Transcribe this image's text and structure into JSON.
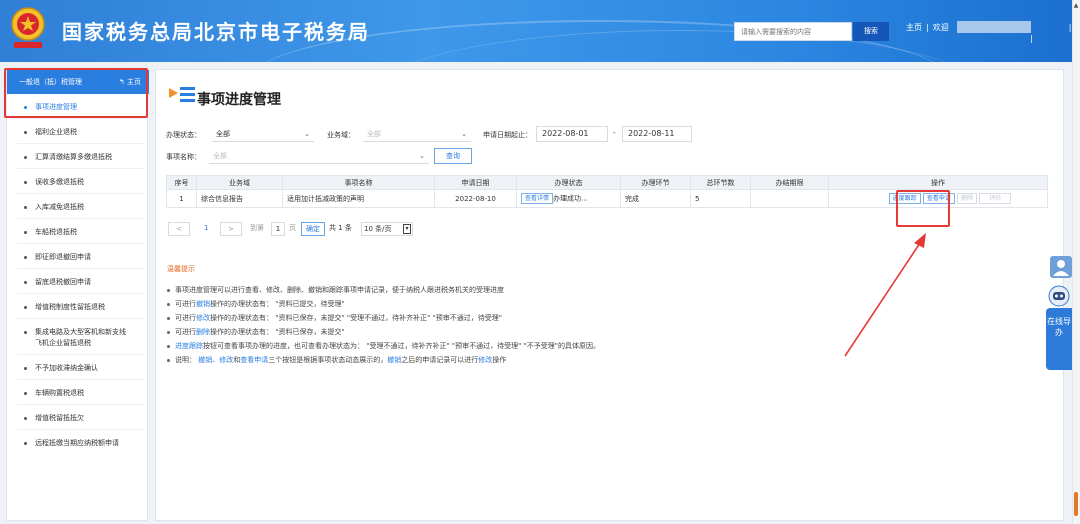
{
  "header": {
    "title": "国家税务总局北京市电子税务局",
    "search_placeholder": "请输入需要搜索的内容",
    "search_button": "搜索",
    "home": "主页",
    "welcome": "欢迎",
    "logout": "退出",
    "sep": "|"
  },
  "sidebar": {
    "head": "一般退（抵）税管理",
    "home": "主页",
    "items": [
      {
        "label": "事项进度管理"
      },
      {
        "label": "福利企业退税"
      },
      {
        "label": "汇算清缴结算多缴退抵税"
      },
      {
        "label": "误收多缴退抵税"
      },
      {
        "label": "入库减免退抵税"
      },
      {
        "label": "车船税退抵税"
      },
      {
        "label": "即征即退撤回申请"
      },
      {
        "label": "留底退税撤回申请"
      },
      {
        "label": "增值税制度性留抵退税"
      },
      {
        "label": "集成电路及大型客机和新支线飞机企业留抵退税"
      },
      {
        "label": "不予加收滞纳金确认"
      },
      {
        "label": "车辆购置税退税"
      },
      {
        "label": "增值税留抵抵欠"
      },
      {
        "label": "远程抵缴当期应纳税额申请"
      }
    ]
  },
  "page": {
    "title": "事项进度管理",
    "filters": {
      "status_label": "办理状态：",
      "status_value": "全部",
      "domain_label": "业务域：",
      "domain_value": "全部",
      "date_label": "申请日期起止：",
      "date_from": "2022-08-01",
      "date_dash": "-",
      "date_to": "2022-08-11",
      "name_label": "事项名称：",
      "name_value": "全部",
      "query_button": "查询"
    },
    "table": {
      "headers": [
        "序号",
        "业务域",
        "事项名称",
        "申请日期",
        "办理状态",
        "办理环节",
        "总环节数",
        "办结期限",
        "操作"
      ],
      "rows": [
        {
          "index": "1",
          "domain": "综合信息报告",
          "name": "适用加计抵减政策的声明",
          "date": "2022-08-10",
          "status_btn": "查看详情",
          "status": "办理成功...",
          "stage": "完成",
          "total": "5",
          "deadline": "",
          "ops": {
            "progress": "进度跟踪",
            "view": "查看申请",
            "delete": "删除",
            "rate": "评价"
          }
        }
      ]
    },
    "pager": {
      "prev": "<",
      "current": "1",
      "next": ">",
      "goto_label": "到第",
      "goto_value": "1",
      "page_unit": "页",
      "confirm": "确定",
      "total": "共 1 条",
      "per_page": "10 条/页"
    },
    "tips": {
      "title": "温馨提示",
      "lines": [
        {
          "parts": [
            {
              "t": "事项进度管理可以进行查看、修改、删除、撤销和跟踪事项申请记录，便于纳税人跟进税务机关的受理进度"
            }
          ]
        },
        {
          "parts": [
            {
              "t": "可进行"
            },
            {
              "t": "撤销",
              "link": true
            },
            {
              "t": "操作的办理状态有：  \"资料已提交，待受理\""
            }
          ]
        },
        {
          "parts": [
            {
              "t": "可进行"
            },
            {
              "t": "修改",
              "link": true
            },
            {
              "t": "操作的办理状态有：  \"资料已保存，未提交\"   \"受理不通过，待补齐补正\"   \"预审不通过，待受理\""
            }
          ]
        },
        {
          "parts": [
            {
              "t": "可进行"
            },
            {
              "t": "删除",
              "link": true
            },
            {
              "t": "操作的办理状态有：  \"资料已保存，未提交\""
            }
          ]
        },
        {
          "parts": [
            {
              "t": "进度跟踪",
              "link": true
            },
            {
              "t": "按钮可查看事项办理的进度，也可查看办理状态为：  \"受理不通过，待补齐补正\"   \"预审不通过，待受理\"   \"不予受理\"的具体原因。"
            }
          ]
        },
        {
          "parts": [
            {
              "t": "说明：  "
            },
            {
              "t": "撤销、修改",
              "link": true
            },
            {
              "t": "和"
            },
            {
              "t": "查看申请",
              "link": true
            },
            {
              "t": "三个按钮是根据事项状态动态展示的，"
            },
            {
              "t": "撤销",
              "link": true
            },
            {
              "t": "之后的申请记录可以进行"
            },
            {
              "t": "修改",
              "link": true
            },
            {
              "t": "操作"
            }
          ]
        }
      ]
    }
  },
  "float": {
    "online_service": "在线导办"
  },
  "colors": {
    "accent": "#2a7ee0",
    "header_start": "#2f7fd6",
    "annotation_red": "#e53935",
    "tip_orange": "#e86a1e"
  }
}
